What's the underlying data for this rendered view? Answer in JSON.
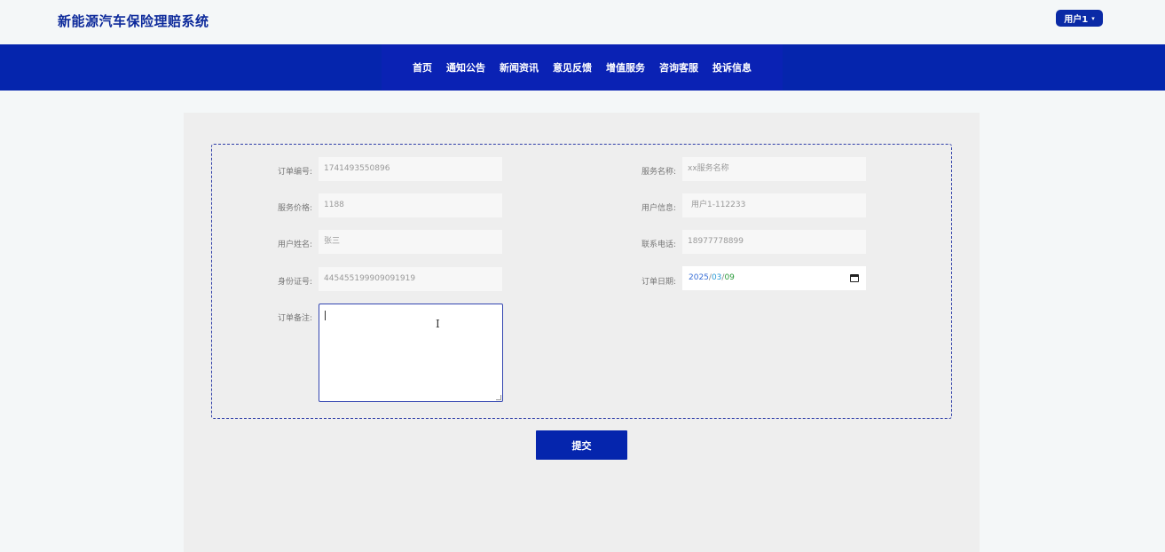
{
  "header": {
    "brand": "新能源汽车保险理赔系统",
    "user_label": "用户1",
    "user_caret": "▾"
  },
  "nav": {
    "items": [
      "首页",
      "通知公告",
      "新闻资讯",
      "意见反馈",
      "增值服务",
      "咨询客服",
      "投诉信息"
    ]
  },
  "form": {
    "order_no": {
      "label": "订单编号:",
      "value": "1741493550896"
    },
    "service_name": {
      "label": "服务名称:",
      "value": "xx服务名称"
    },
    "service_price": {
      "label": "服务价格:",
      "value": "1188"
    },
    "user_info": {
      "label": "用户信息:",
      "value": "用户1-112233"
    },
    "user_name": {
      "label": "用户姓名:",
      "value": "张三"
    },
    "phone": {
      "label": "联系电话:",
      "value": "18977778899"
    },
    "id_card": {
      "label": "身份证号:",
      "value": "445455199909091919"
    },
    "order_date": {
      "label": "订单日期:",
      "year": "2025",
      "month": "03",
      "day": "09",
      "sep": "/"
    },
    "remark": {
      "label": "订单备注:",
      "value": ""
    }
  },
  "submit_label": "提交",
  "colors": {
    "primary": "#0525ad",
    "brand_text": "#0d2a9b",
    "panel_bg": "#eeeeee"
  }
}
